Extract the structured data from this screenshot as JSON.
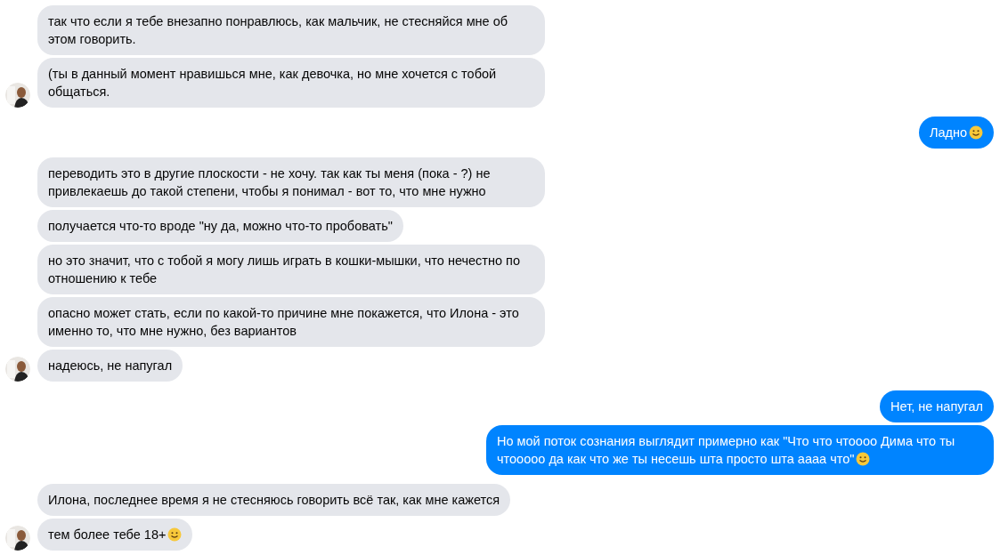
{
  "groups": [
    {
      "kind": "incoming",
      "messages": [
        {
          "text": "так что если я тебе внезапно понравлюсь, как мальчик, не стесняйся мне об этом говорить.",
          "smiley": false
        },
        {
          "text": "(ты в данный момент нравишься мне, как девочка, но мне хочется с тобой общаться.",
          "smiley": false
        }
      ]
    },
    {
      "kind": "outgoing",
      "messages": [
        {
          "text": "Ладно",
          "smiley": true
        }
      ]
    },
    {
      "kind": "incoming",
      "messages": [
        {
          "text": "переводить это в другие плоскости - не хочу. так как ты меня (пока - ?) не привлекаешь до такой степени, чтобы я понимал - вот то, что мне нужно",
          "smiley": false
        },
        {
          "text": "получается что-то вроде \"ну да, можно что-то пробовать\"",
          "smiley": false
        },
        {
          "text": "но это значит, что с тобой я могу лишь играть в кошки-мышки, что нечестно по отношению к тебе",
          "smiley": false
        },
        {
          "text": "опасно может стать, если по какой-то причине мне покажется, что Илона - это именно то, что мне нужно, без вариантов",
          "smiley": false
        },
        {
          "text": "надеюсь, не напугал",
          "smiley": false
        }
      ]
    },
    {
      "kind": "outgoing",
      "messages": [
        {
          "text": "Нет, не напугал",
          "smiley": false
        },
        {
          "text": "Но мой поток сознания выглядит примерно как \"Что что чтоооо Дима что ты чтооооо да как что же ты несешь шта просто шта аааа что\"",
          "smiley": true
        }
      ]
    },
    {
      "kind": "incoming",
      "messages": [
        {
          "text": "Илона, последнее время я не стесняюсь говорить всё так, как мне кажется",
          "smiley": false
        },
        {
          "text": "тем более тебе 18+",
          "smiley": true
        }
      ]
    }
  ]
}
